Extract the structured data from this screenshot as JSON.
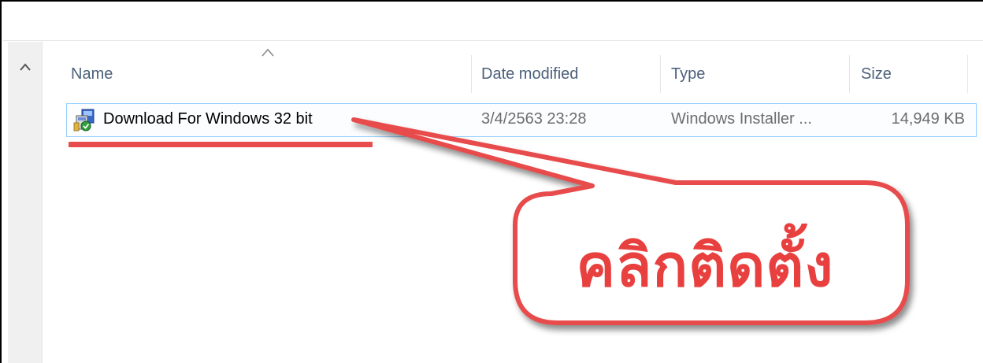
{
  "columns": {
    "name": "Name",
    "date_modified": "Date modified",
    "type": "Type",
    "size": "Size"
  },
  "file": {
    "name": "Download For Windows 32 bit",
    "date_modified": "3/4/2563 23:28",
    "type": "Windows Installer ...",
    "size": "14,949 KB",
    "icon": "windows-installer-icon"
  },
  "annotation": {
    "text": "คลิกติดตั้ง",
    "color": "#e8403f"
  },
  "colors": {
    "selection_border": "#99d1ff",
    "header_text": "#4c607a",
    "secondary_text": "#6d6d6d",
    "underline": "#e84c4c"
  }
}
